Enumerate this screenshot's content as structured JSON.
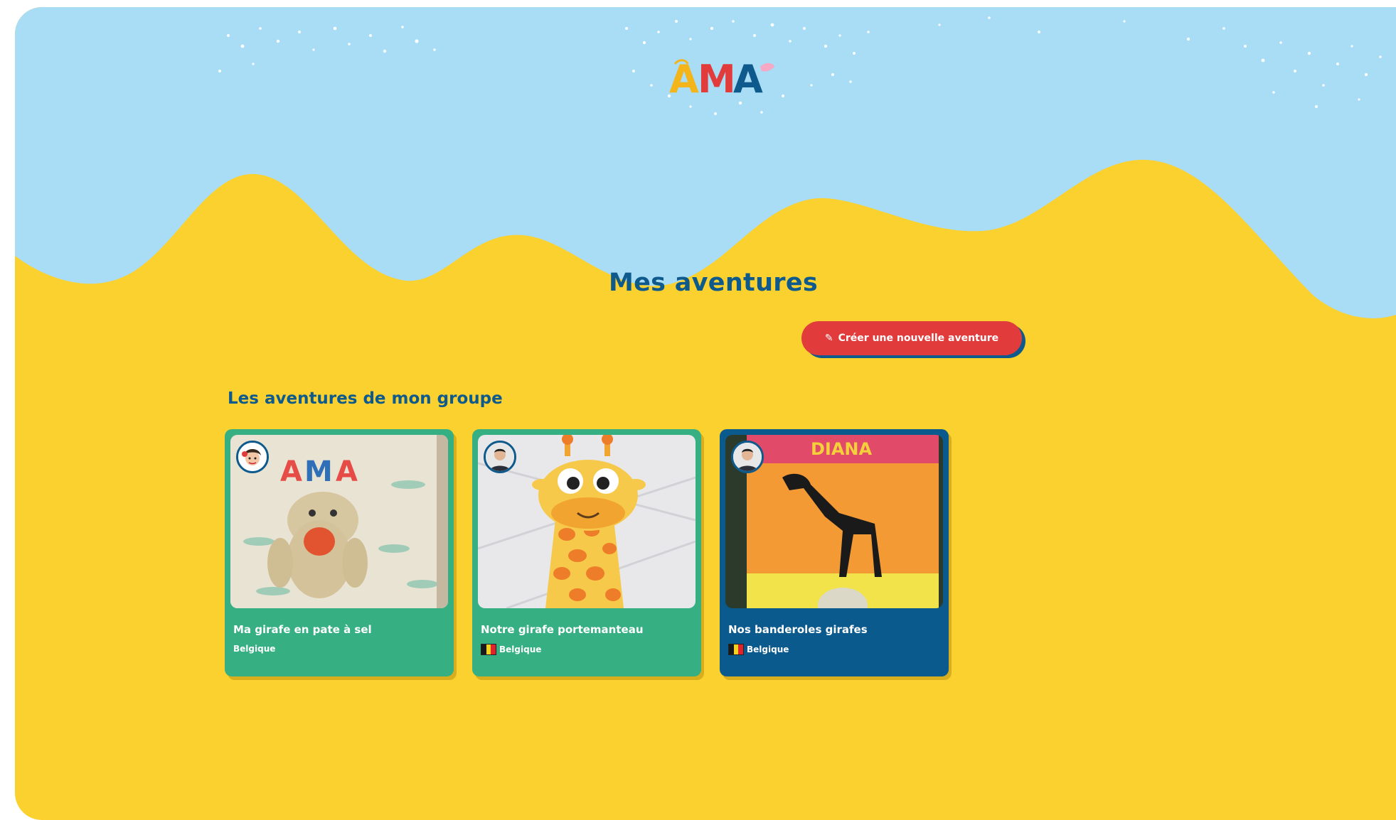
{
  "header": {
    "logo_text": "AMA",
    "logo_icon": "ama-logo"
  },
  "page": {
    "title": "Mes aventures"
  },
  "actions": {
    "create_label": "Créer une nouvelle aventure",
    "create_icon": "pencil-icon"
  },
  "section": {
    "title": "Les aventures de mon groupe"
  },
  "cards": [
    {
      "title": "Ma girafe en pate à sel",
      "country": "Belgique",
      "show_flag": false,
      "color": "#36b082"
    },
    {
      "title": "Notre girafe portemanteau",
      "country": "Belgique",
      "show_flag": true,
      "color": "#36b082"
    },
    {
      "title": "Nos banderoles girafes",
      "country": "Belgique",
      "show_flag": true,
      "color": "#0a5a8e"
    }
  ],
  "colors": {
    "sky": "#a9dcf5",
    "ground": "#fad12f",
    "primary_text": "#0e5a8c",
    "button": "#e23b3b",
    "belgium_flag": [
      "#1a1a1a",
      "#f3d320",
      "#e0222a"
    ]
  }
}
